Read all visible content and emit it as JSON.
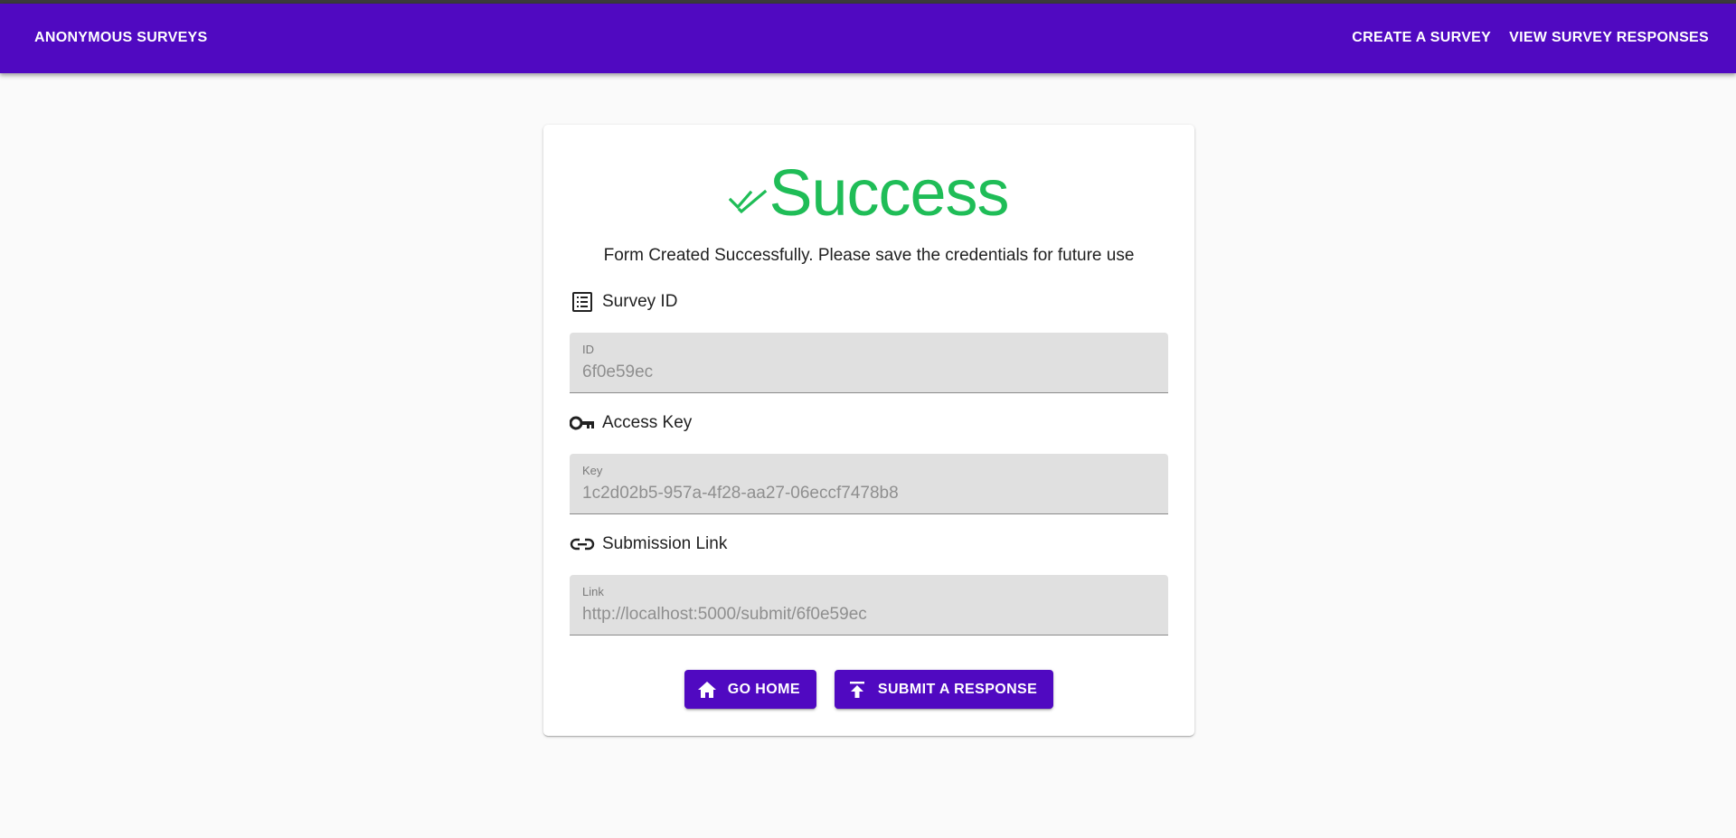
{
  "appbar": {
    "brand": "ANONYMOUS SURVEYS",
    "nav": [
      {
        "label": "CREATE A SURVEY"
      },
      {
        "label": "VIEW SURVEY RESPONSES"
      }
    ]
  },
  "card": {
    "title": "Success",
    "title_icon": "double-check-icon",
    "subtitle": "Form Created Successfully. Please save the credentials for future use",
    "sections": [
      {
        "heading": "Survey ID",
        "icon": "list-icon",
        "field_label": "ID",
        "field_value": "6f0e59ec"
      },
      {
        "heading": "Access Key",
        "icon": "key-icon",
        "field_label": "Key",
        "field_value": "1c2d02b5-957a-4f28-aa27-06eccf7478b8"
      },
      {
        "heading": "Submission Link",
        "icon": "link-icon",
        "field_label": "Link",
        "field_value": "http://localhost:5000/submit/6f0e59ec"
      }
    ],
    "buttons": {
      "home": {
        "label": "GO HOME",
        "icon": "home-icon"
      },
      "submit": {
        "label": "SUBMIT A RESPONSE",
        "icon": "upload-icon"
      }
    }
  },
  "colors": {
    "primary": "#5009c1",
    "success": "#1fbd57",
    "background": "#fafafa",
    "field_bg": "#e0e0e0"
  }
}
